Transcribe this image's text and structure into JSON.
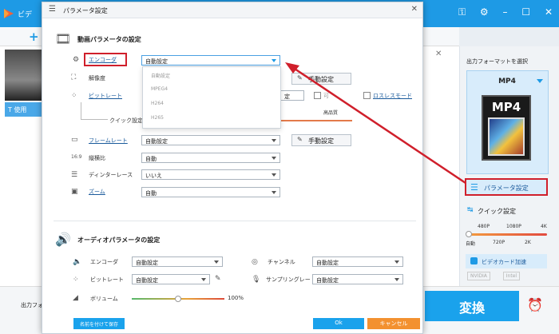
{
  "app": {
    "title": "ビデ",
    "add_icon": "+",
    "file_tab_label": "使用",
    "output_folder_label": "出力フォ",
    "right_panel": {
      "output_format_title": "出力フォーマットを選択",
      "format_name": "MP4",
      "format_icon_label": "MP4",
      "param_button_label": "パラメータ設定",
      "quick_label": "クイック設定",
      "quick_ticks_top": [
        "480P",
        "1080P",
        "4K"
      ],
      "quick_ticks_bottom": [
        "自動",
        "720P",
        "2K"
      ],
      "gpu_label": "ビデオカード加速",
      "vendors": [
        "NVIDIA",
        "Intel"
      ]
    },
    "convert_label": "変換"
  },
  "dialog": {
    "title": "パラメータ設定",
    "video_section_title": "動画パラメータの設定",
    "audio_section_title": "オーディオパラメータの設定",
    "video": {
      "encoder_label": "エンコーダ",
      "encoder_value": "自動設定",
      "encoder_options": [
        "自動設定",
        "MPEG4",
        "H264",
        "H265"
      ],
      "resolution_label": "解像度",
      "bitrate_label": "ビットレート",
      "bitrate_partial_text": "定",
      "vbr_label": "可",
      "lossless_label": "ロスレスモード",
      "quick_setting_label": "クイック設定",
      "high_quality_label": "高品質",
      "framerate_label": "フレームレート",
      "framerate_value": "自動設定",
      "aspect_label": "縦横比",
      "aspect_value": "自動",
      "deinterlace_label": "ディンターレース",
      "deinterlace_value": "いいえ",
      "zoom_label": "ズーム",
      "zoom_value": "自動",
      "manual_button_label": "手動設定"
    },
    "audio": {
      "encoder_label": "エンコーダ",
      "encoder_value": "自動設定",
      "channel_label": "チャンネル",
      "channel_value": "自動設定",
      "bitrate_label": "ビットレート",
      "bitrate_value": "自動設定",
      "samplerate_label": "サンプリングレート",
      "samplerate_value": "自動設定",
      "volume_label": "ボリューム",
      "volume_value": "100%",
      "volume_level": 0.5
    },
    "save_as_label": "名前を付けて保存",
    "ok_label": "Ok",
    "cancel_label": "キャンセル"
  },
  "colors": {
    "accent": "#1aa2ec",
    "annotation_red": "#d01f2b",
    "cancel_orange": "#f39130"
  }
}
